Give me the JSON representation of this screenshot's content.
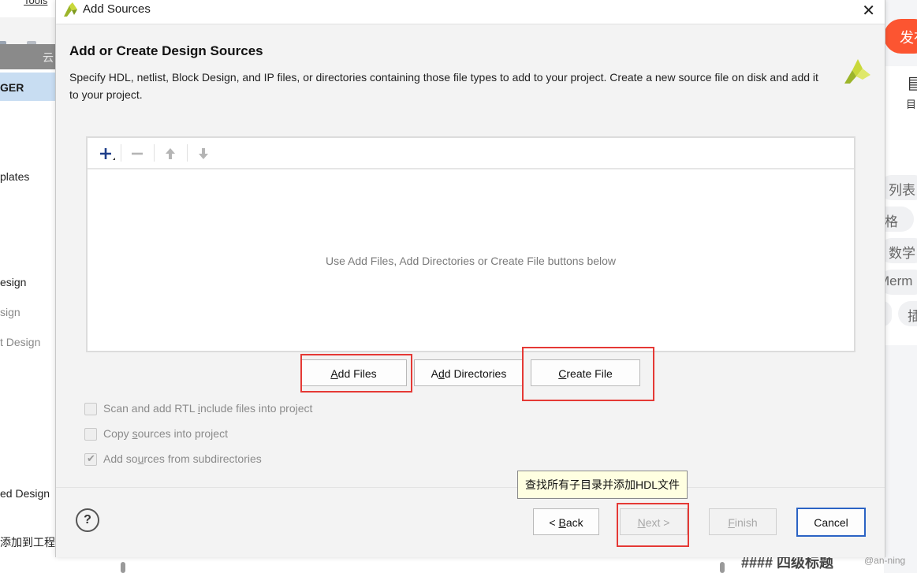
{
  "background_left": {
    "menu_tools": "Tools",
    "header_partial": "云",
    "selected_item": "GER",
    "items": [
      {
        "label": "plates"
      },
      {
        "label": "esign"
      },
      {
        "label": "sign"
      },
      {
        "label": "t Design"
      },
      {
        "label": "ed Design"
      },
      {
        "label": "添加到工程"
      }
    ]
  },
  "background_right": {
    "publish_label": "发布",
    "icon_label": "目",
    "chips": [
      "列表",
      "表格",
      "数学",
      "Merm",
      "插"
    ],
    "bottom_heading": "#### 四级标题",
    "watermark": "@an-ning"
  },
  "dialog": {
    "title": "Add Sources",
    "heading": "Add or Create Design Sources",
    "description": "Specify HDL, netlist, Block Design, and IP files, or directories containing those file types to add to your project. Create a new source file on disk and add it to your project.",
    "toolbar": {
      "add_icon": "plus-icon",
      "remove_icon": "minus-icon",
      "up_icon": "arrow-up-icon",
      "down_icon": "arrow-down-icon"
    },
    "empty_message": "Use Add Files, Add Directories or Create File buttons below",
    "buttons": {
      "add_files": {
        "pre": "",
        "key": "A",
        "post": "dd Files"
      },
      "add_directories": {
        "pre": "A",
        "key": "d",
        "post": "d Directories"
      },
      "create_file": {
        "pre": "",
        "key": "C",
        "post": "reate File"
      }
    },
    "options": [
      {
        "pre": "Scan and add RTL ",
        "key": "i",
        "post": "nclude files into project",
        "checked": false
      },
      {
        "pre": "Copy ",
        "key": "s",
        "post": "ources into project",
        "checked": false
      },
      {
        "pre": "Add so",
        "key": "u",
        "post": "rces from subdirectories",
        "checked": true
      }
    ],
    "tooltip": "查找所有子目录并添加HDL文件",
    "footer": {
      "help": "?",
      "back": {
        "pre": "< ",
        "key": "B",
        "post": "ack"
      },
      "next": {
        "pre": "",
        "key": "N",
        "post": "ext >"
      },
      "finish": {
        "pre": "",
        "key": "F",
        "post": "inish"
      },
      "cancel": "Cancel"
    }
  },
  "colors": {
    "highlight_red": "#e53935",
    "selection_blue": "#c8ddf2",
    "focus_blue": "#2b63c4",
    "publish_orange": "#fc5531"
  }
}
